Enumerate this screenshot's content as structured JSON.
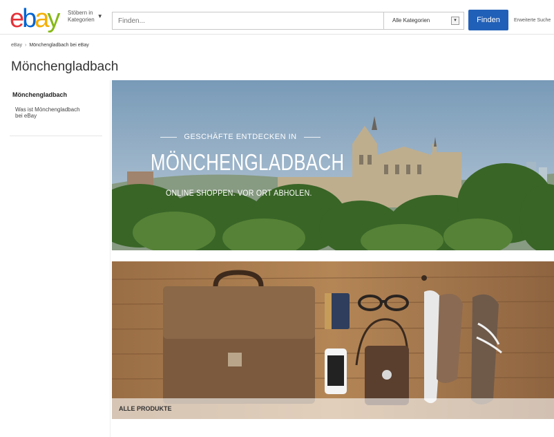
{
  "header": {
    "logo_letters": [
      {
        "char": "e",
        "color": "#e53238"
      },
      {
        "char": "b",
        "color": "#0064d2"
      },
      {
        "char": "a",
        "color": "#f5af02"
      },
      {
        "char": "y",
        "color": "#86b817"
      }
    ],
    "browse_label_line1": "Stöbern in",
    "browse_label_line2": "Kategorien",
    "search_placeholder": "Finden...",
    "category_selected": "Alle Kategorien",
    "find_label": "Finden",
    "advanced_link": "Erweiterte Suche",
    "accent_color": "#2160b8"
  },
  "breadcrumb": {
    "items": [
      "eBay",
      "Mönchengladbach bei eBay"
    ]
  },
  "page_title": "Mönchengladbach",
  "sidebar": {
    "heading": "Mönchengladbach",
    "items": [
      {
        "label": "Was ist Mönchengladbach bei eBay"
      }
    ]
  },
  "hero": {
    "pre_title": "GESCHÄFTE ENTDECKEN IN",
    "title": "MÖNCHENGLADBACH",
    "subtitle": "ONLINE SHOPPEN. VOR ORT ABHOLEN."
  },
  "products": {
    "label": "ALLE PRODUKTE"
  }
}
